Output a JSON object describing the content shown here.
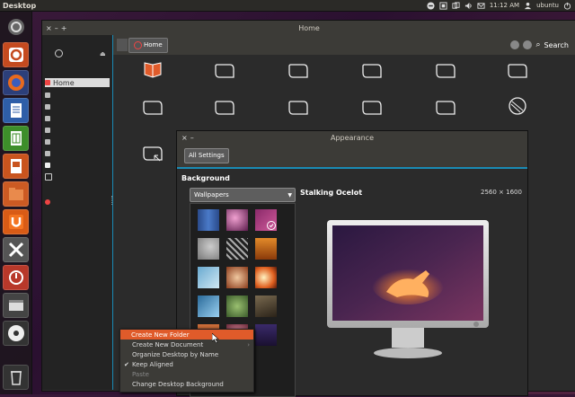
{
  "panel": {
    "title": "Desktop",
    "time": "11:12 AM",
    "user": "ubuntu"
  },
  "launcher": {
    "items": [
      {
        "name": "dash-icon"
      },
      {
        "name": "software-center-icon"
      },
      {
        "name": "firefox-icon"
      },
      {
        "name": "writer-icon"
      },
      {
        "name": "calc-icon"
      },
      {
        "name": "impress-icon"
      },
      {
        "name": "files-icon"
      },
      {
        "name": "ubuntu-one-icon"
      },
      {
        "name": "system-settings-icon"
      },
      {
        "name": "update-manager-icon"
      },
      {
        "name": "workspace-icon"
      },
      {
        "name": "disc-icon"
      },
      {
        "name": "trash-icon"
      }
    ]
  },
  "files": {
    "title": "Home",
    "breadcrumb": "Home",
    "search_label": "Search",
    "sidebar_home": "Home"
  },
  "appearance": {
    "title": "Appearance",
    "all_settings": "All Settings",
    "background_heading": "Background",
    "source_select": "Wallpapers",
    "wallpaper_name": "Stalking Ocelot",
    "wallpaper_size": "2560 × 1600"
  },
  "context_menu": {
    "items": [
      {
        "label": "Create New Folder",
        "highlighted": true
      },
      {
        "label": "Create New Document",
        "submenu": true
      },
      {
        "label": "Organize Desktop by Name"
      },
      {
        "label": "Keep Aligned",
        "checked": true
      },
      {
        "label": "Paste",
        "disabled": true
      },
      {
        "label": "Change Desktop Background"
      }
    ]
  },
  "colors": {
    "accent": "#1a8bb5",
    "highlight": "#e05b2a"
  }
}
